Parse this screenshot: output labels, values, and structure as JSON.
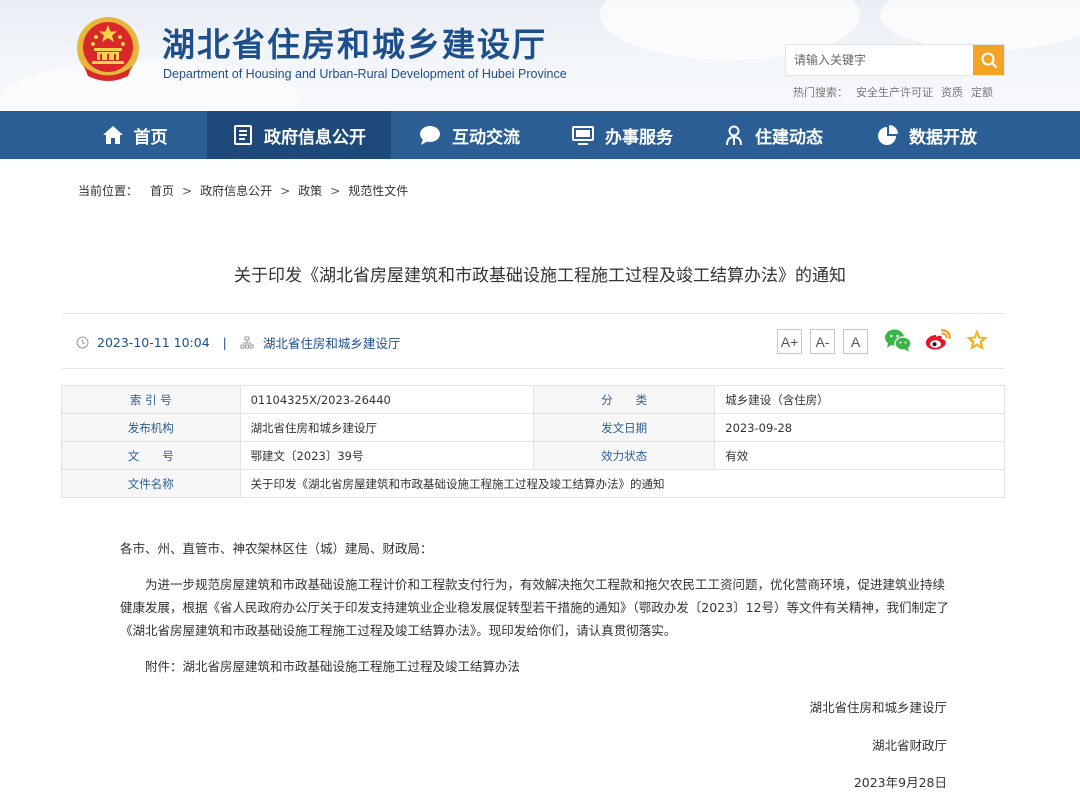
{
  "header": {
    "title": "湖北省住房和城乡建设厅",
    "subtitle": "Department of Housing and Urban-Rural Development of Hubei Province",
    "search_placeholder": "请输入关键字",
    "hot_label": "热门搜索：",
    "hot_terms": [
      "安全生产许可证",
      "资质",
      "定额"
    ]
  },
  "nav": {
    "items": [
      {
        "label": "首页",
        "icon": "home-icon"
      },
      {
        "label": "政府信息公开",
        "icon": "document-icon"
      },
      {
        "label": "互动交流",
        "icon": "chat-bubble-icon"
      },
      {
        "label": "办事服务",
        "icon": "monitor-icon"
      },
      {
        "label": "住建动态",
        "icon": "news-person-icon"
      },
      {
        "label": "数据开放",
        "icon": "pie-chart-icon"
      }
    ]
  },
  "breadcrumb": {
    "label": "当前位置：",
    "items": [
      "首页",
      "政府信息公开",
      "政策",
      "规范性文件"
    ],
    "separator": ">"
  },
  "article": {
    "title": "关于印发《湖北省房屋建筑和市政基础设施工程施工过程及竣工结算办法》的通知",
    "datetime": "2023-10-11 10:04",
    "meta_divider": "|",
    "source": "湖北省住房和城乡建设厅",
    "font_sizes": [
      "A+",
      "A-",
      "A"
    ]
  },
  "info": {
    "rows": [
      [
        {
          "label": "索 引 号",
          "value": "01104325X/2023-26440"
        },
        {
          "label": "分　　类",
          "value": "城乡建设（含住房）"
        }
      ],
      [
        {
          "label": "发布机构",
          "value": "湖北省住房和城乡建设厅"
        },
        {
          "label": "发文日期",
          "value": "2023-09-28"
        }
      ],
      [
        {
          "label": "文　　号",
          "value": "鄂建文〔2023〕39号"
        },
        {
          "label": "效力状态",
          "value": "有效"
        }
      ]
    ],
    "name_label": "文件名称",
    "name_value": "关于印发《湖北省房屋建筑和市政基础设施工程施工过程及竣工结算办法》的通知"
  },
  "body": {
    "salutation": "各市、州、直管市、神农架林区住（城）建局、财政局：",
    "paragraph": "为进一步规范房屋建筑和市政基础设施工程计价和工程款支付行为，有效解决拖欠工程款和拖欠农民工工资问题，优化营商环境，促进建筑业持续健康发展，根据《省人民政府办公厅关于印发支持建筑业企业稳发展促转型若干措施的通知》（鄂政办发〔2023〕12号）等文件有关精神，我们制定了《湖北省房屋建筑和市政基础设施工程施工过程及竣工结算办法》。现印发给你们，请认真贯彻落实。",
    "attachment": "附件：湖北省房屋建筑和市政基础设施工程施工过程及竣工结算办法",
    "signer1": "湖北省住房和城乡建设厅",
    "signer2": "湖北省财政厅",
    "date": "2023年9月28日"
  },
  "colors": {
    "nav_bg": "#2a5e94",
    "nav_active": "#1d4a7b",
    "brand_blue": "#1d4f8c",
    "search_btn": "#f3a425",
    "wechat_green": "#3bb44a",
    "weibo_red": "#e6162d",
    "star_gold": "#f2b31e"
  }
}
